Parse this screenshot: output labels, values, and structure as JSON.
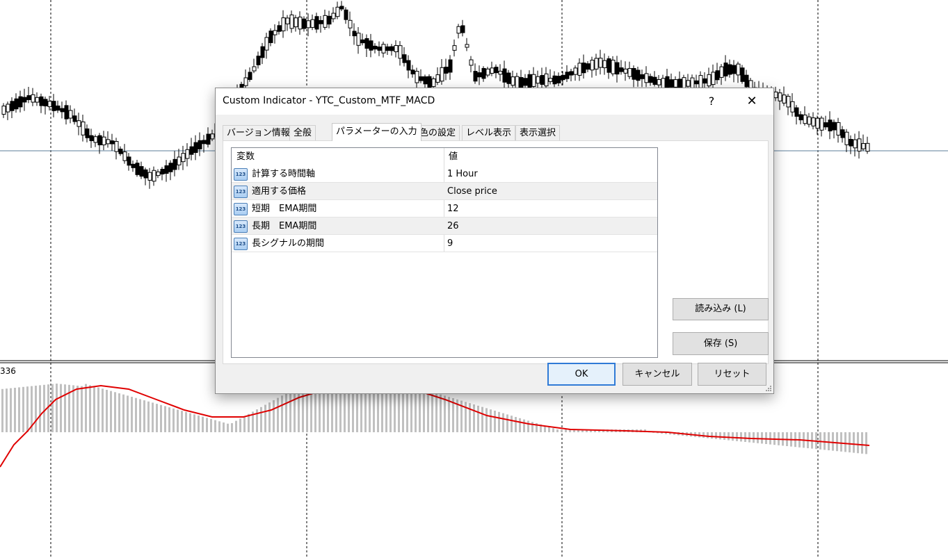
{
  "chart": {
    "sub_window_label": "336",
    "colors": {
      "grid_line": "#000000",
      "candle": "#000000",
      "histogram": "#c0c0c0",
      "signal": "#e00000",
      "price_line": "#5b7d9a"
    }
  },
  "dialog": {
    "title": "Custom Indicator - YTC_Custom_MTF_MACD",
    "help_label": "?",
    "close_label": "✕",
    "tabs": [
      {
        "label": "バージョン情報"
      },
      {
        "label": "全般"
      },
      {
        "label": "パラメーターの入力"
      },
      {
        "label": "色の設定"
      },
      {
        "label": "レベル表示"
      },
      {
        "label": "表示選択"
      }
    ],
    "active_tab": "パラメーターの入力",
    "table": {
      "col_variable": "変数",
      "col_value": "値",
      "rows": [
        {
          "icon": "123",
          "name": "計算する時間軸",
          "value": "1 Hour"
        },
        {
          "icon": "123",
          "name": "適用する価格",
          "value": "Close price"
        },
        {
          "icon": "123",
          "name": "短期　EMA期間",
          "value": "12"
        },
        {
          "icon": "123",
          "name": "長期　EMA期間",
          "value": "26"
        },
        {
          "icon": "123",
          "name": "長シグナルの期間",
          "value": "9"
        }
      ]
    },
    "buttons": {
      "load": "読み込み (L)",
      "save": "保存 (S)",
      "ok": "OK",
      "cancel": "キャンセル",
      "reset": "リセット"
    }
  }
}
